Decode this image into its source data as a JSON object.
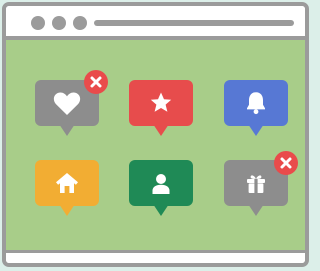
{
  "window": {
    "tiles": [
      {
        "icon": "heart-icon",
        "color": "#8d8d8d",
        "state": "disabled",
        "has_close_badge": true
      },
      {
        "icon": "star-icon",
        "color": "#e74c4c",
        "state": "active",
        "has_close_badge": false
      },
      {
        "icon": "bell-icon",
        "color": "#5778d4",
        "state": "active",
        "has_close_badge": false
      },
      {
        "icon": "home-icon",
        "color": "#f2ad33",
        "state": "active",
        "has_close_badge": false
      },
      {
        "icon": "user-icon",
        "color": "#1f8a56",
        "state": "active",
        "has_close_badge": false
      },
      {
        "icon": "gift-icon",
        "color": "#8d8d8d",
        "state": "disabled",
        "has_close_badge": true
      }
    ],
    "colors": {
      "frame": "#9b9b9b",
      "content_background": "#a8cd89",
      "page_background": "#dcefe9",
      "close_badge": "#e94b4b"
    }
  }
}
